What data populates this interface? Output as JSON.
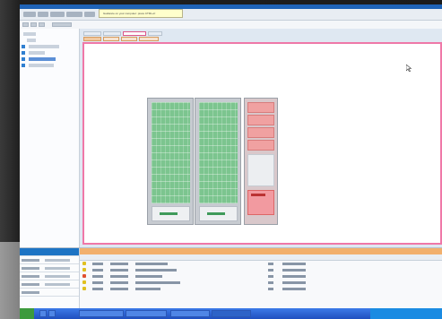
{
  "tooltip": {
    "text": "Guidance on your computer: press CTRL+F"
  },
  "colors": {
    "rack_green": "#7cc58f",
    "rack_red": "#f0a1a1",
    "canvas_border": "#ef78a8",
    "log_toolbar": "#f2b06d",
    "titlebar": "#1f63b7"
  },
  "icons": {
    "cursor": "mouse-pointer-icon",
    "tree_nodes": "tree-node-icon",
    "log_severity": "status-square-icon"
  }
}
